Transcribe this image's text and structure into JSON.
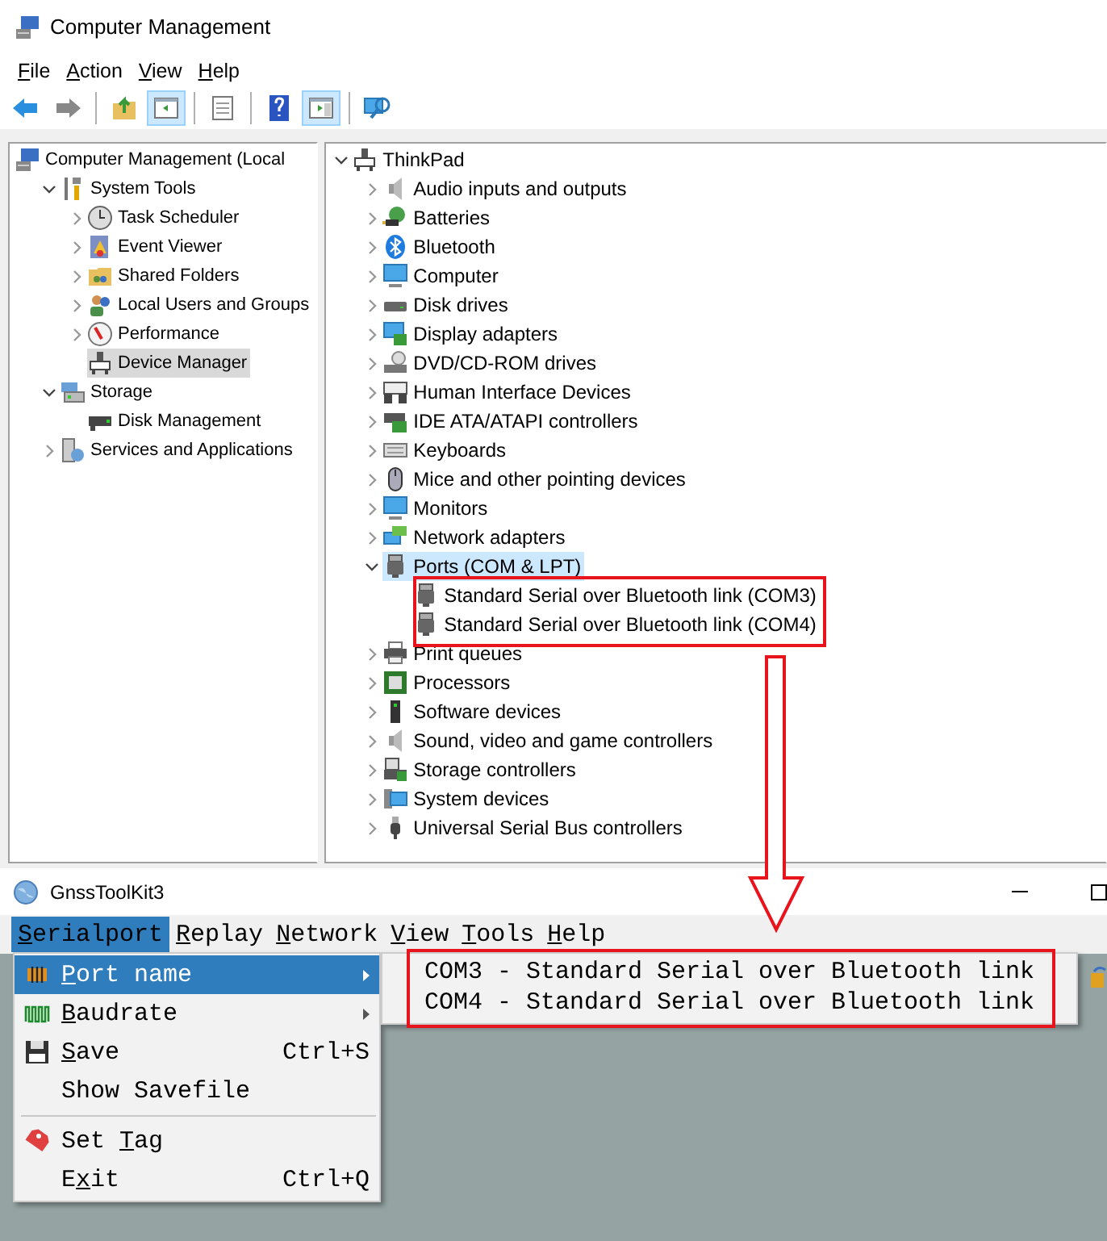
{
  "cm_window": {
    "title": "Computer Management",
    "menu": [
      {
        "parts": {
          "key": "F",
          "after": "ile"
        }
      },
      {
        "parts": {
          "key": "A",
          "after": "ction"
        }
      },
      {
        "parts": {
          "key": "V",
          "after": "iew"
        }
      },
      {
        "parts": {
          "key": "H",
          "after": "elp"
        }
      }
    ],
    "toolbar": [
      {
        "kind": "button",
        "pressed": false
      },
      {
        "kind": "button",
        "pressed": false
      },
      {
        "kind": "separator"
      },
      {
        "kind": "button",
        "pressed": false
      },
      {
        "kind": "button",
        "pressed": true
      },
      {
        "kind": "separator"
      },
      {
        "kind": "button",
        "pressed": false
      },
      {
        "kind": "separator"
      },
      {
        "kind": "button",
        "pressed": false
      },
      {
        "kind": "button",
        "pressed": true
      },
      {
        "kind": "separator"
      },
      {
        "kind": "button",
        "pressed": false
      }
    ]
  },
  "left_tree": [
    {
      "label": "Computer Management (Local",
      "selected": false,
      "children": [
        {
          "label": "System Tools",
          "expanded": true,
          "selected": false,
          "children": [
            {
              "label": "Task Scheduler",
              "expanded": false,
              "selected": false
            },
            {
              "label": "Event Viewer",
              "expanded": false,
              "selected": false
            },
            {
              "label": "Shared Folders",
              "expanded": false,
              "selected": false
            },
            {
              "label": "Local Users and Groups",
              "expanded": false,
              "selected": false
            },
            {
              "label": "Performance",
              "expanded": false,
              "selected": false
            },
            {
              "label": "Device Manager",
              "selected": true
            }
          ]
        },
        {
          "label": "Storage",
          "expanded": true,
          "selected": false,
          "children": [
            {
              "label": "Disk Management",
              "selected": false
            }
          ]
        },
        {
          "label": "Services and Applications",
          "expanded": false,
          "selected": false
        }
      ]
    }
  ],
  "right_tree": [
    {
      "label": "ThinkPad",
      "expanded": true,
      "selected": false,
      "children": [
        {
          "label": "Audio inputs and outputs",
          "expanded": false,
          "selected": false
        },
        {
          "label": "Batteries",
          "expanded": false,
          "selected": false
        },
        {
          "label": "Bluetooth",
          "expanded": false,
          "selected": false
        },
        {
          "label": "Computer",
          "expanded": false,
          "selected": false
        },
        {
          "label": "Disk drives",
          "expanded": false,
          "selected": false
        },
        {
          "label": "Display adapters",
          "expanded": false,
          "selected": false
        },
        {
          "label": "DVD/CD-ROM drives",
          "expanded": false,
          "selected": false
        },
        {
          "label": "Human Interface Devices",
          "expanded": false,
          "selected": false
        },
        {
          "label": "IDE ATA/ATAPI controllers",
          "expanded": false,
          "selected": false
        },
        {
          "label": "Keyboards",
          "expanded": false,
          "selected": false
        },
        {
          "label": "Mice and other pointing devices",
          "expanded": false,
          "selected": false
        },
        {
          "label": "Monitors",
          "expanded": false,
          "selected": false
        },
        {
          "label": "Network adapters",
          "expanded": false,
          "selected": false
        },
        {
          "label": "Ports (COM & LPT)",
          "expanded": true,
          "selected": true,
          "children": [
            {
              "label": "Standard Serial over Bluetooth link (COM3)",
              "selected": false
            },
            {
              "label": "Standard Serial over Bluetooth link (COM4)",
              "selected": false
            }
          ]
        },
        {
          "label": "Print queues",
          "expanded": false,
          "selected": false
        },
        {
          "label": "Processors",
          "expanded": false,
          "selected": false
        },
        {
          "label": "Software devices",
          "expanded": false,
          "selected": false
        },
        {
          "label": "Sound, video and game controllers",
          "expanded": false,
          "selected": false
        },
        {
          "label": "Storage controllers",
          "expanded": false,
          "selected": false
        },
        {
          "label": "System devices",
          "expanded": false,
          "selected": false
        },
        {
          "label": "Universal Serial Bus controllers",
          "expanded": false,
          "selected": false
        }
      ]
    }
  ],
  "gnss_window": {
    "title": "GnssToolKit3",
    "menu": [
      {
        "parts": {
          "key": "S",
          "after": "erialport"
        },
        "selected": true
      },
      {
        "parts": {
          "key": "R",
          "after": "eplay"
        },
        "selected": false
      },
      {
        "parts": {
          "key": "N",
          "after": "etwork"
        },
        "selected": false
      },
      {
        "parts": {
          "key": "V",
          "after": "iew"
        },
        "selected": false
      },
      {
        "parts": {
          "key": "T",
          "after": "ools"
        },
        "selected": false
      },
      {
        "parts": {
          "key": "H",
          "after": "elp"
        },
        "selected": false
      }
    ],
    "dropdown": [
      {
        "kind": "item",
        "parts": {
          "key": "P",
          "after": "ort name"
        },
        "submenu": true,
        "selected": true
      },
      {
        "kind": "item",
        "parts": {
          "key": "B",
          "after": "audrate"
        },
        "submenu": true,
        "selected": false
      },
      {
        "kind": "item",
        "parts": {
          "key": "S",
          "after": "ave"
        },
        "shortcut": "Ctrl+S",
        "selected": false
      },
      {
        "kind": "item",
        "parts": {
          "before": "Show Savefile"
        },
        "selected": false
      },
      {
        "kind": "separator"
      },
      {
        "kind": "item",
        "parts": {
          "before": "Set ",
          "key": "T",
          "after": "ag"
        },
        "selected": false
      },
      {
        "kind": "item",
        "parts": {
          "before": "E",
          "key": "x",
          "after": "it"
        },
        "shortcut": "Ctrl+Q",
        "selected": false
      }
    ],
    "submenu": [
      {
        "label": "COM3 - Standard Serial over Bluetooth link"
      },
      {
        "label": "COM4 - Standard Serial over Bluetooth link"
      }
    ]
  }
}
